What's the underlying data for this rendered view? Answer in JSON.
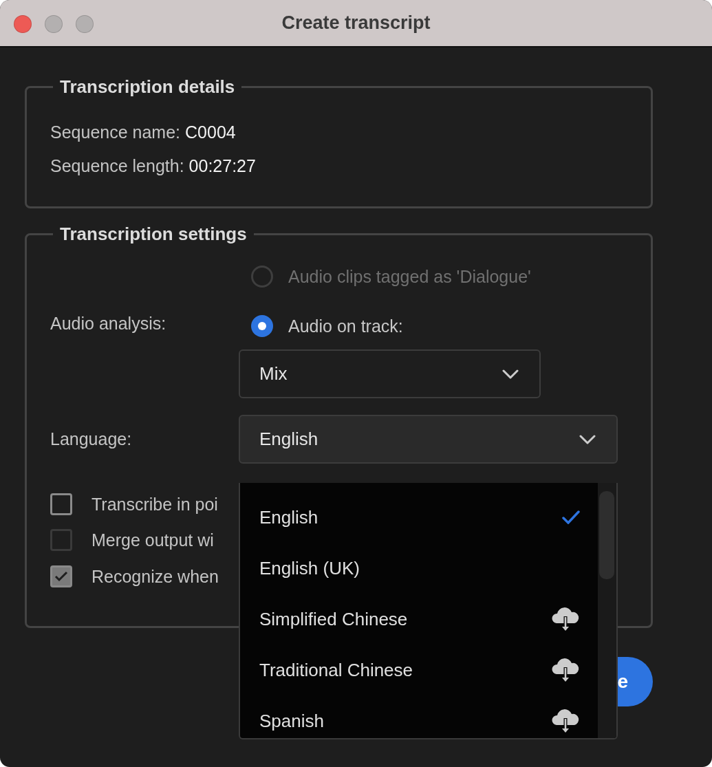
{
  "window": {
    "title": "Create transcript"
  },
  "details": {
    "title": "Transcription details",
    "fields": [
      {
        "label": "Sequence name:",
        "value": "C0004"
      },
      {
        "label": "Sequence length:",
        "value": "00:27:27"
      }
    ]
  },
  "settings": {
    "title": "Transcription settings",
    "audio_analysis": {
      "label": "Audio analysis:",
      "options": [
        {
          "label": "Audio clips tagged as 'Dialogue'",
          "selected": false,
          "disabled": true
        },
        {
          "label": "Audio on track:",
          "selected": true,
          "disabled": false
        }
      ],
      "track": {
        "value": "Mix"
      }
    },
    "language": {
      "label": "Language:",
      "value": "English",
      "expanded": true
    },
    "checkboxes": [
      {
        "label": "Transcribe in poi",
        "checked": false,
        "disabled": false
      },
      {
        "label": "Merge output wi",
        "checked": false,
        "disabled": true
      },
      {
        "label": "Recognize when",
        "checked": true,
        "disabled": false
      }
    ]
  },
  "language_menu": {
    "items": [
      {
        "label": "English",
        "selected": true,
        "download": false
      },
      {
        "label": "English (UK)",
        "selected": false,
        "download": false
      },
      {
        "label": "Simplified Chinese",
        "selected": false,
        "download": true
      },
      {
        "label": "Traditional Chinese",
        "selected": false,
        "download": true
      },
      {
        "label": "Spanish",
        "selected": false,
        "download": true
      }
    ]
  },
  "button": {
    "label": "e"
  }
}
